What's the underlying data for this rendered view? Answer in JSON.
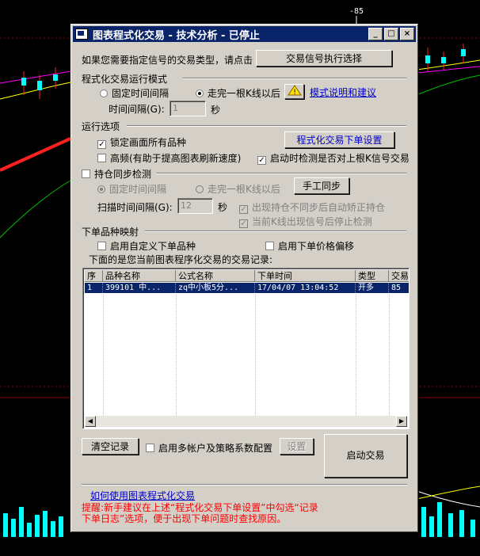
{
  "background": {
    "price_label": "-85"
  },
  "window": {
    "title": "图表程式化交易 - 技术分析 - 已停止",
    "controls": {
      "minimize": "_",
      "maximize": "□",
      "close": "×"
    }
  },
  "signal_prompt": {
    "text": "如果您需要指定信号的交易类型，请点击",
    "button": "交易信号执行选择"
  },
  "run_mode": {
    "title": "程式化交易运行模式",
    "fixed_interval": "固定时间间隔",
    "after_kline": "走完一根K线以后",
    "help_link": "模式说明和建议",
    "interval_label": "时间间隔(G):",
    "interval_value": "1",
    "interval_unit": "秒"
  },
  "run_options": {
    "title": "运行选项",
    "lock_all": "锁定画面所有品种",
    "order_settings_button": "程式化交易下单设置",
    "high_freq": "高频(有助于提高图表刷新速度)",
    "startup_check": "启动时检测是否对上根K信号交易"
  },
  "sync": {
    "title": "持仓同步检测",
    "fixed_interval": "固定时间间隔",
    "after_kline": "走完一根K线以后",
    "manual_button": "手工同步",
    "scan_label": "扫描时间间隔(G):",
    "scan_value": "12",
    "scan_unit": "秒",
    "auto_fix": "出现持仓不同步后自动矫正持仓",
    "stop_check": "当前K线出现信号后停止检测"
  },
  "mapping": {
    "title": "下单品种映射",
    "custom_product": "启用自定义下单品种",
    "price_offset": "启用下单价格偏移",
    "records_label": "下面的是您当前图表程序化交易的交易记录:"
  },
  "table": {
    "columns": [
      "序",
      "品种名称",
      "公式名称",
      "下单时间",
      "类型",
      "交易"
    ],
    "rows": [
      [
        "1",
        "399101 中...",
        "zq中小板5分...",
        "17/04/07 13:04:52",
        "开多",
        "85"
      ]
    ]
  },
  "footer": {
    "clear_button": "清空记录",
    "multi_account": "启用多帐户及策略系数配置",
    "settings_button": "设置",
    "start_button": "启动交易",
    "how_to_link": "如何使用图表程式化交易",
    "tip_line1": "提醒:新手建议在上述“程式化交易下单设置”中勾选“记录",
    "tip_line2": "下单日志”选项，便于出现下单问题时查找原因。"
  },
  "colors": {
    "title_bar": "#0a246a",
    "link": "#0000cc",
    "tip": "#ff0000"
  }
}
